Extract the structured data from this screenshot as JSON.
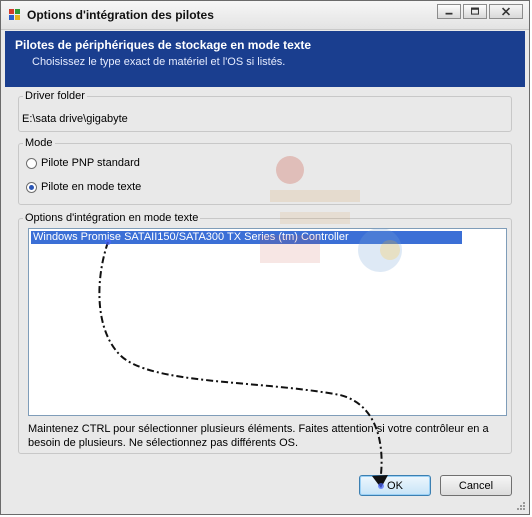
{
  "window": {
    "title": "Options d'intégration des pilotes",
    "controls": [
      "minimize-icon",
      "maximize-icon",
      "close-icon"
    ]
  },
  "header": {
    "title": "Pilotes de périphériques de stockage en mode texte",
    "subtitle": "Choisissez le type exact de matériel et l'OS si listés."
  },
  "driver_folder": {
    "label": "Driver folder",
    "path": "E:\\sata drive\\gigabyte"
  },
  "mode": {
    "label": "Mode",
    "options": [
      {
        "label": "Pilote PNP standard",
        "checked": false
      },
      {
        "label": "Pilote en mode texte",
        "checked": true
      }
    ]
  },
  "textmode_options": {
    "label": "Options d'intégration en mode texte",
    "items": [
      {
        "label": "Windows Promise SATAII150/SATA300 TX Series (tm) Controller",
        "selected": true
      }
    ],
    "help": "Maintenez CTRL pour sélectionner plusieurs éléments. Faites attention si votre contrôleur en a besoin de plusieurs. Ne sélectionnez pas différents OS."
  },
  "buttons": {
    "ok": "OK",
    "cancel": "Cancel"
  },
  "colors": {
    "header_bg": "#1a3e8f",
    "selection": "#3b6fd6"
  }
}
